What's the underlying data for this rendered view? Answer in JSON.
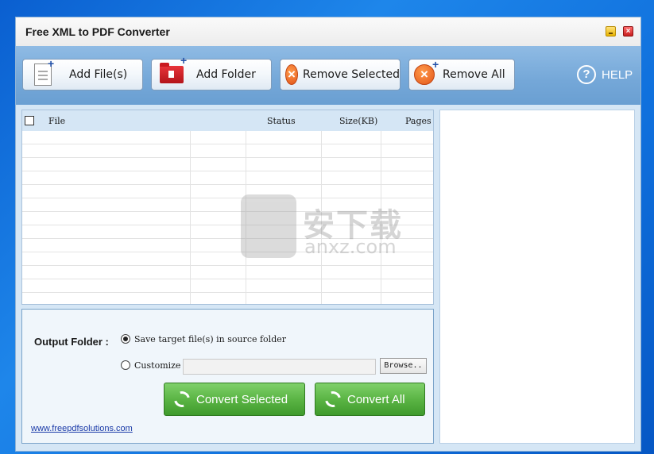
{
  "window": {
    "title": "Free XML to PDF Converter"
  },
  "toolbar": {
    "add_files": "Add File(s)",
    "add_folder": "Add Folder",
    "remove_selected": "Remove Selected",
    "remove_all": "Remove All",
    "help": "HELP"
  },
  "file_list": {
    "columns": {
      "file": "File",
      "status": "Status",
      "size": "Size(KB)",
      "pages": "Pages"
    },
    "rows": []
  },
  "output": {
    "label": "Output Folder :",
    "option_source": "Save target file(s) in source folder",
    "option_custom": "Customize",
    "custom_path": "",
    "browse": "Browse..",
    "convert_selected": "Convert Selected",
    "convert_all": "Convert All",
    "link": "www.freepdfsolutions.com"
  },
  "watermark": {
    "brand": "安下载",
    "domain": "anxz.com"
  },
  "icons": [
    "document-add-icon",
    "folder-add-icon",
    "remove-icon",
    "help-icon",
    "convert-icon"
  ],
  "colors": {
    "toolbar": "#74a7d8",
    "convert_button": "#5bb545",
    "remove_icon": "#e2561a",
    "folder_icon": "#c9191f"
  }
}
